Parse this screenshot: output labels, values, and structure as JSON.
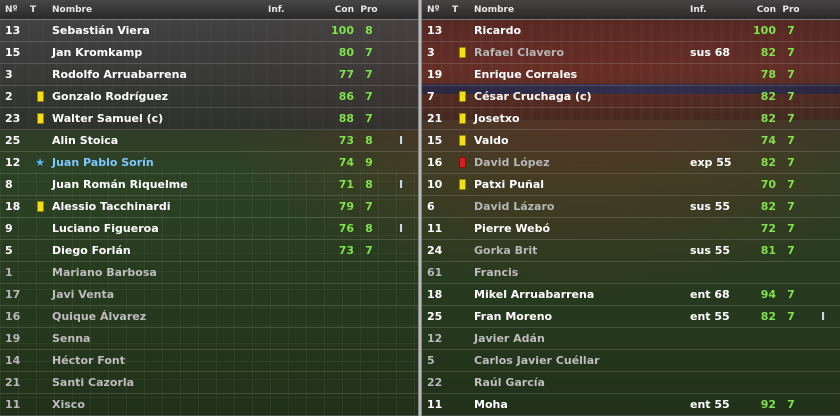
{
  "columns": {
    "num": "Nº",
    "t": "T",
    "name": "Nombre",
    "inf": "Inf.",
    "con": "Con",
    "pro": "Pro"
  },
  "left_rows": [
    {
      "num": "13",
      "card": "",
      "name": "Sebastián Viera",
      "inf": "",
      "con": "100",
      "pro": "8",
      "extra": "",
      "style": ""
    },
    {
      "num": "15",
      "card": "",
      "name": "Jan Kromkamp",
      "inf": "",
      "con": "80",
      "pro": "7",
      "extra": "",
      "style": ""
    },
    {
      "num": "3",
      "card": "",
      "name": "Rodolfo Arruabarrena",
      "inf": "",
      "con": "77",
      "pro": "7",
      "extra": "",
      "style": ""
    },
    {
      "num": "2",
      "card": "yellow",
      "name": "Gonzalo Rodríguez",
      "inf": "",
      "con": "86",
      "pro": "7",
      "extra": "",
      "style": ""
    },
    {
      "num": "23",
      "card": "yellow",
      "name": "Walter Samuel (c)",
      "inf": "",
      "con": "88",
      "pro": "7",
      "extra": "",
      "style": ""
    },
    {
      "num": "25",
      "card": "",
      "name": "Alin Stoica",
      "inf": "",
      "con": "73",
      "pro": "8",
      "extra": "I",
      "style": ""
    },
    {
      "num": "12",
      "card": "star",
      "name": "Juan Pablo Sorín",
      "inf": "",
      "con": "74",
      "pro": "9",
      "extra": "",
      "style": "blue"
    },
    {
      "num": "8",
      "card": "",
      "name": "Juan Román Riquelme",
      "inf": "",
      "con": "71",
      "pro": "8",
      "extra": "I",
      "style": ""
    },
    {
      "num": "18",
      "card": "yellow",
      "name": "Alessio Tacchinardi",
      "inf": "",
      "con": "79",
      "pro": "7",
      "extra": "",
      "style": ""
    },
    {
      "num": "9",
      "card": "",
      "name": "Luciano Figueroa",
      "inf": "",
      "con": "76",
      "pro": "8",
      "extra": "I",
      "style": ""
    },
    {
      "num": "5",
      "card": "",
      "name": "Diego Forlán",
      "inf": "",
      "con": "73",
      "pro": "7",
      "extra": "",
      "style": ""
    },
    {
      "num": "1",
      "card": "",
      "name": "Mariano Barbosa",
      "inf": "",
      "con": "",
      "pro": "",
      "extra": "",
      "style": "dim"
    },
    {
      "num": "17",
      "card": "",
      "name": "Javi Venta",
      "inf": "",
      "con": "",
      "pro": "",
      "extra": "",
      "style": "dim"
    },
    {
      "num": "16",
      "card": "",
      "name": "Quique Álvarez",
      "inf": "",
      "con": "",
      "pro": "",
      "extra": "",
      "style": "dim"
    },
    {
      "num": "19",
      "card": "",
      "name": "Senna",
      "inf": "",
      "con": "",
      "pro": "",
      "extra": "",
      "style": "dim"
    },
    {
      "num": "14",
      "card": "",
      "name": "Héctor Font",
      "inf": "",
      "con": "",
      "pro": "",
      "extra": "",
      "style": "dim"
    },
    {
      "num": "21",
      "card": "",
      "name": "Santi Cazorla",
      "inf": "",
      "con": "",
      "pro": "",
      "extra": "",
      "style": "dim"
    },
    {
      "num": "11",
      "card": "",
      "name": "Xisco",
      "inf": "",
      "con": "",
      "pro": "",
      "extra": "",
      "style": "dim"
    }
  ],
  "right_rows": [
    {
      "num": "13",
      "card": "",
      "name": "Ricardo",
      "inf": "",
      "con": "100",
      "pro": "7",
      "extra": "",
      "style": ""
    },
    {
      "num": "3",
      "card": "yellow",
      "name": "Rafael Clavero",
      "inf": "sus 68",
      "con": "82",
      "pro": "7",
      "extra": "",
      "style": "gray"
    },
    {
      "num": "19",
      "card": "",
      "name": "Enrique Corrales",
      "inf": "",
      "con": "78",
      "pro": "7",
      "extra": "",
      "style": ""
    },
    {
      "num": "7",
      "card": "yellow",
      "name": "César Cruchaga (c)",
      "inf": "",
      "con": "82",
      "pro": "7",
      "extra": "",
      "style": ""
    },
    {
      "num": "21",
      "card": "yellow",
      "name": "Josetxo",
      "inf": "",
      "con": "82",
      "pro": "7",
      "extra": "",
      "style": ""
    },
    {
      "num": "15",
      "card": "yellow",
      "name": "Valdo",
      "inf": "",
      "con": "74",
      "pro": "7",
      "extra": "",
      "style": ""
    },
    {
      "num": "16",
      "card": "red",
      "name": "David López",
      "inf": "exp 55",
      "con": "82",
      "pro": "7",
      "extra": "",
      "style": "gray"
    },
    {
      "num": "10",
      "card": "yellow",
      "name": "Patxi Puñal",
      "inf": "",
      "con": "70",
      "pro": "7",
      "extra": "",
      "style": ""
    },
    {
      "num": "6",
      "card": "",
      "name": "David Lázaro",
      "inf": "sus 55",
      "con": "82",
      "pro": "7",
      "extra": "",
      "style": "gray"
    },
    {
      "num": "11",
      "card": "",
      "name": "Pierre Webó",
      "inf": "",
      "con": "72",
      "pro": "7",
      "extra": "",
      "style": ""
    },
    {
      "num": "24",
      "card": "",
      "name": "Gorka Brit",
      "inf": "sus 55",
      "con": "81",
      "pro": "7",
      "extra": "",
      "style": "gray"
    },
    {
      "num": "61",
      "card": "",
      "name": "Francis",
      "inf": "",
      "con": "",
      "pro": "",
      "extra": "",
      "style": "dim"
    },
    {
      "num": "18",
      "card": "",
      "name": "Mikel Arruabarrena",
      "inf": "ent 68",
      "con": "94",
      "pro": "7",
      "extra": "",
      "style": ""
    },
    {
      "num": "25",
      "card": "",
      "name": "Fran Moreno",
      "inf": "ent 55",
      "con": "82",
      "pro": "7",
      "extra": "I",
      "style": ""
    },
    {
      "num": "12",
      "card": "",
      "name": "Javier Adán",
      "inf": "",
      "con": "",
      "pro": "",
      "extra": "",
      "style": "dim"
    },
    {
      "num": "5",
      "card": "",
      "name": "Carlos Javier Cuéllar",
      "inf": "",
      "con": "",
      "pro": "",
      "extra": "",
      "style": "dim"
    },
    {
      "num": "22",
      "card": "",
      "name": "Raúl García",
      "inf": "",
      "con": "",
      "pro": "",
      "extra": "",
      "style": "dim"
    },
    {
      "num": "11",
      "card": "",
      "name": "Moha",
      "inf": "ent 55",
      "con": "92",
      "pro": "7",
      "extra": "",
      "style": ""
    }
  ],
  "colors": {
    "yellow_card": "#f2de12",
    "red_card": "#d81e1e",
    "condition_green": "#7fe24a",
    "captain_star_blue": "#58b6ff"
  }
}
